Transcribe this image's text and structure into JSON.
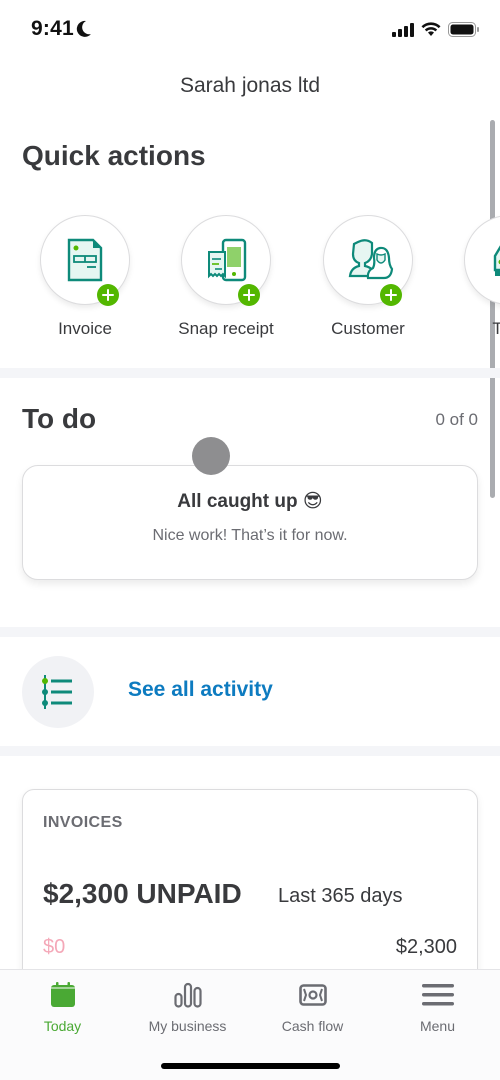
{
  "status_bar": {
    "time": "9:41",
    "focus_icon": "moon-icon",
    "icons": [
      "signal-icon",
      "wifi-icon",
      "battery-icon"
    ]
  },
  "header": {
    "company_name": "Sarah jonas ltd"
  },
  "quick_actions": {
    "title": "Quick actions",
    "items": [
      {
        "label": "Invoice",
        "icon": "invoice-icon"
      },
      {
        "label": "Snap receipt",
        "icon": "receipt-phone-icon"
      },
      {
        "label": "Customer",
        "icon": "customer-icon"
      },
      {
        "label": "Trac",
        "icon": "car-icon"
      }
    ]
  },
  "todo": {
    "title": "To do",
    "count": "0 of 0",
    "card_title": "All caught up 😎",
    "card_subtitle": "Nice work! That’s it for now."
  },
  "activity": {
    "link_label": "See all activity",
    "icon": "activity-list-icon"
  },
  "invoices": {
    "heading": "INVOICES",
    "amount_label": "$2,300 UNPAID",
    "period": "Last 365 days",
    "range_min": "$0",
    "range_max": "$2,300"
  },
  "tab_bar": {
    "tabs": [
      {
        "label": "Today",
        "icon": "calendar-icon",
        "active": true
      },
      {
        "label": "My business",
        "icon": "bar-chart-icon",
        "active": false
      },
      {
        "label": "Cash flow",
        "icon": "cash-icon",
        "active": false
      },
      {
        "label": "Menu",
        "icon": "hamburger-menu-icon",
        "active": false
      }
    ]
  },
  "colors": {
    "brand_green": "#53b700",
    "active_tab": "#4aa934",
    "link_blue": "#0d7bc0",
    "icon_teal": "#0e8a7a",
    "text_primary": "#393a3d",
    "text_secondary": "#6b6c72",
    "negative_pink": "#f4a8b8"
  }
}
